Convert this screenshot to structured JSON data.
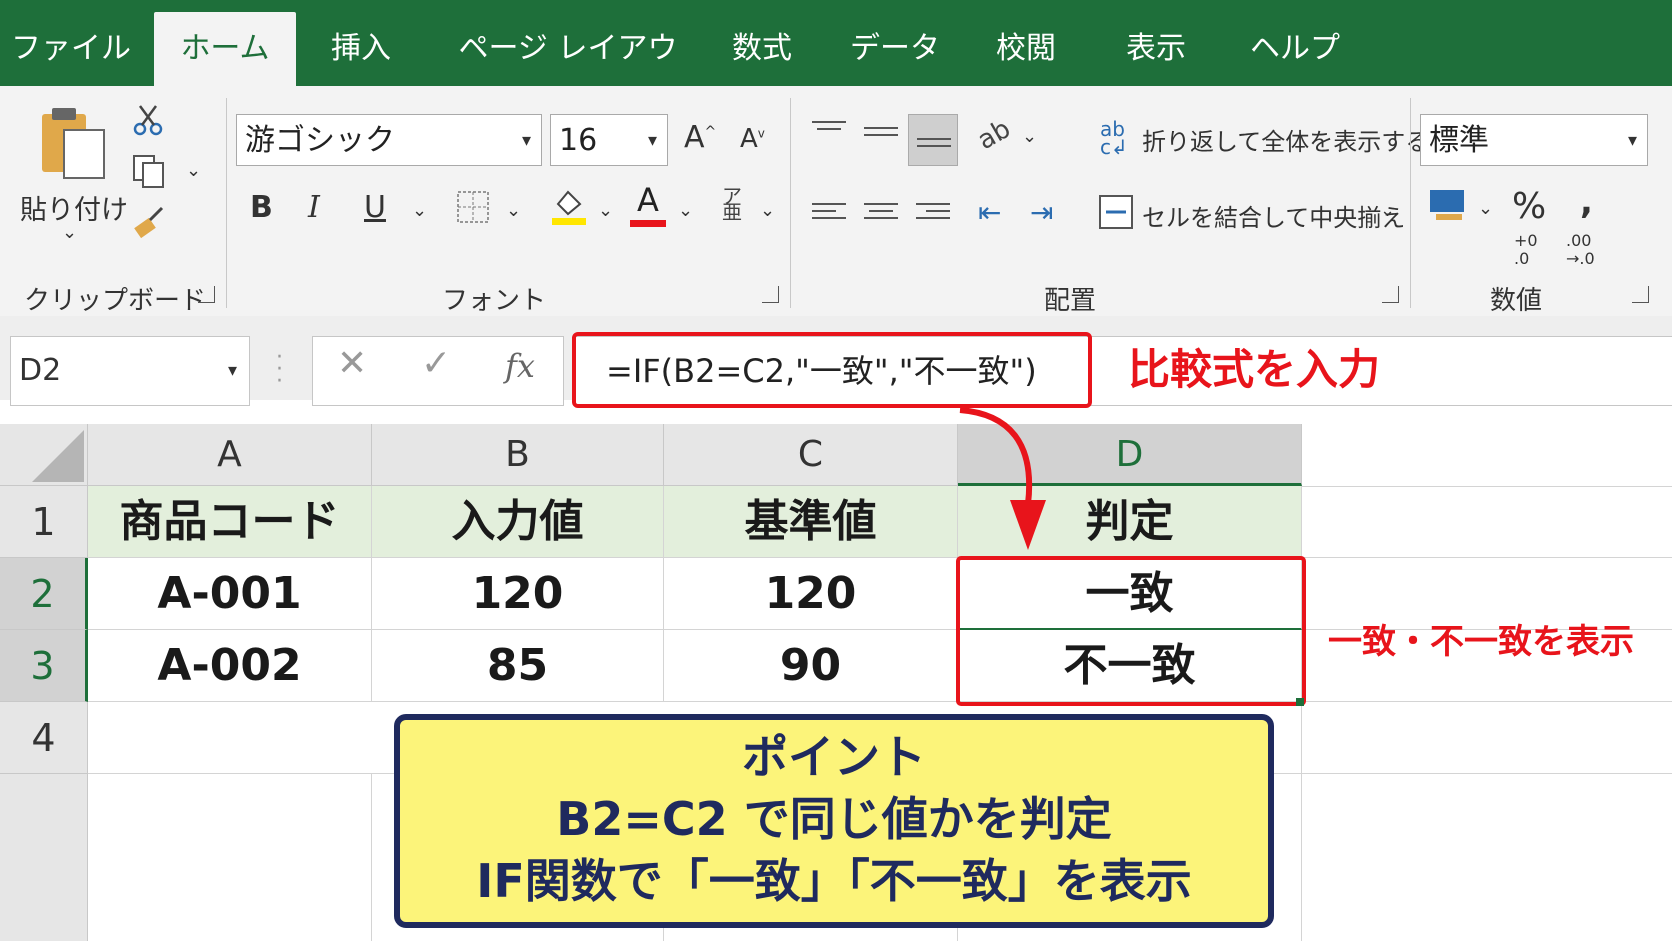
{
  "tabs": [
    "ファイル",
    "ホーム",
    "挿入",
    "ページ レイアウト",
    "数式",
    "データ",
    "校閲",
    "表示",
    "ヘルプ"
  ],
  "active_tab": "ホーム",
  "ribbon": {
    "clipboard": {
      "paste_label": "貼り付け",
      "group_label": "クリップボード"
    },
    "font": {
      "font_name": "游ゴシック",
      "font_size": "16",
      "bold": "B",
      "italic": "I",
      "underline": "U",
      "font_color_letter": "A",
      "grow": "A",
      "shrink": "A",
      "group_label": "フォント"
    },
    "alignment": {
      "wrap_label": "折り返して全体を表示する",
      "merge_label": "セルを結合して中央揃え",
      "group_label": "配置"
    },
    "number": {
      "format": "標準",
      "percent": "%",
      "comma": ",",
      "inc_decimal": "+0\n.0",
      "dec_decimal": ".00\n→.0",
      "group_label": "数値"
    }
  },
  "formula_bar": {
    "name_box": "D2",
    "cancel": "✕",
    "enter": "✓",
    "fx": "fx",
    "formula": "=IF(B2=C2,\"一致\",\"不一致\")"
  },
  "annotation_formula": "比較式を入力",
  "columns": [
    "A",
    "B",
    "C",
    "D"
  ],
  "rows": [
    "1",
    "2",
    "3",
    "4"
  ],
  "table": {
    "headers": [
      "商品コード",
      "入力値",
      "基準値",
      "判定"
    ],
    "data": [
      [
        "A-001",
        "120",
        "120",
        "一致"
      ],
      [
        "A-002",
        "85",
        "90",
        "不一致"
      ]
    ]
  },
  "annotation_result": "一致・不一致を表示",
  "point_box": [
    "ポイント",
    "B2=C2 で同じ値かを判定",
    "IF関数で「一致」「不一致」を表示"
  ],
  "colors": {
    "excel_green": "#1e6f3a",
    "highlight_red": "#e8141b",
    "header_fill": "#e3efdc",
    "note_yellow": "#fcf47a",
    "note_border": "#1f2a5e"
  }
}
